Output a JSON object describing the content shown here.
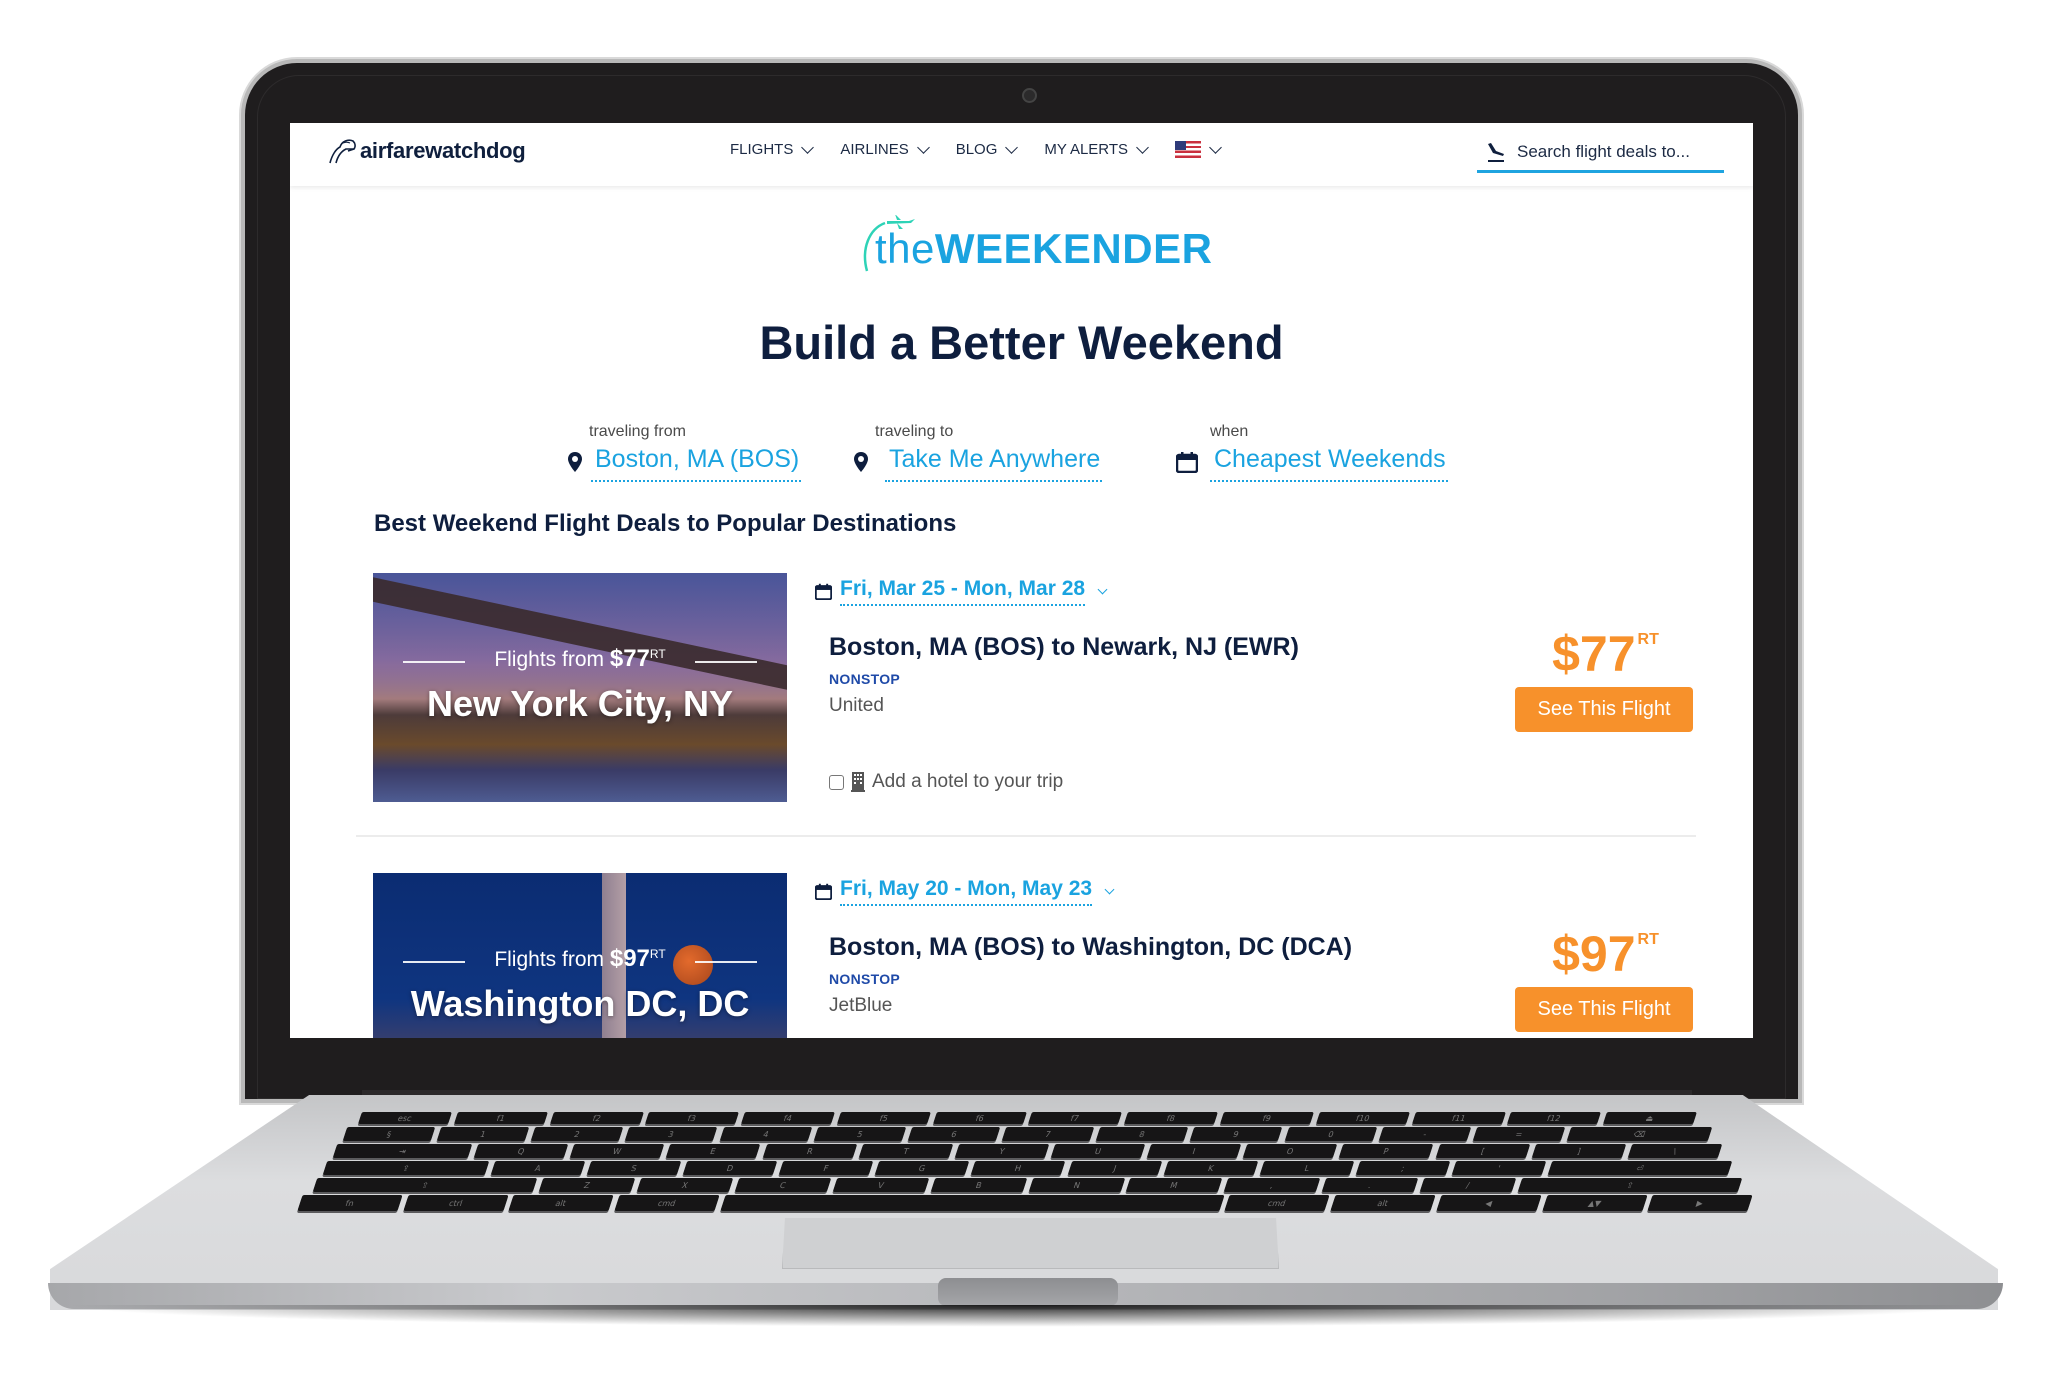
{
  "nav": {
    "brand": "airfarewatchdog",
    "items": [
      {
        "label": "FLIGHTS"
      },
      {
        "label": "AIRLINES"
      },
      {
        "label": "BLOG"
      },
      {
        "label": "MY ALERTS"
      }
    ],
    "locale_icon": "us-flag-icon",
    "search_placeholder": "Search flight deals to..."
  },
  "hero": {
    "logo_the": "the",
    "logo_weekender": "WEEKENDER",
    "title": "Build a Better Weekend"
  },
  "search": {
    "from": {
      "label": "traveling from",
      "value": "Boston, MA (BOS)",
      "icon": "map-pin-icon"
    },
    "to": {
      "label": "traveling to",
      "value": "Take Me Anywhere",
      "icon": "map-pin-icon"
    },
    "when": {
      "label": "when",
      "value": "Cheapest Weekends",
      "icon": "calendar-icon"
    }
  },
  "section_title": "Best Weekend Flight Deals to Popular Destinations",
  "deals": [
    {
      "flights_from_label": "Flights from",
      "flights_from_price": "$77",
      "rt": "RT",
      "city": "New York City, NY",
      "dates": "Fri, Mar 25 - Mon, Mar 28",
      "route": "Boston, MA (BOS) to Newark, NJ (EWR)",
      "stops": "NONSTOP",
      "airline": "United",
      "hotel_label": "Add a hotel to your trip",
      "hotel_checked": false,
      "price": "$77",
      "price_suffix": "RT",
      "cta": "See This Flight"
    },
    {
      "flights_from_label": "Flights from",
      "flights_from_price": "$97",
      "rt": "RT",
      "city": "Washington DC, DC",
      "dates": "Fri, May 20 - Mon, May 23",
      "route": "Boston, MA (BOS) to Washington, DC (DCA)",
      "stops": "NONSTOP",
      "airline": "JetBlue",
      "price": "$97",
      "price_suffix": "RT",
      "cta": "See This Flight"
    }
  ],
  "colors": {
    "accent": "#1aa3e0",
    "navy": "#0e1e3e",
    "cta": "#f7912b",
    "logo_swoosh": "#2ed3b7"
  },
  "keyboard": {
    "row0": [
      "esc",
      "f1",
      "f2",
      "f3",
      "f4",
      "f5",
      "f6",
      "f7",
      "f8",
      "f9",
      "f10",
      "f11",
      "f12",
      "⏏"
    ],
    "row1": [
      "§",
      "1",
      "2",
      "3",
      "4",
      "5",
      "6",
      "7",
      "8",
      "9",
      "0",
      "-",
      "=",
      "⌫"
    ],
    "row2": [
      "⇥",
      "Q",
      "W",
      "E",
      "R",
      "T",
      "Y",
      "U",
      "I",
      "O",
      "P",
      "[",
      "]",
      "\\"
    ],
    "row3": [
      "⇪",
      "A",
      "S",
      "D",
      "F",
      "G",
      "H",
      "J",
      "K",
      "L",
      ";",
      "'",
      "⏎"
    ],
    "row4": [
      "⇧",
      "Z",
      "X",
      "C",
      "V",
      "B",
      "N",
      "M",
      ",",
      ".",
      "/",
      "⇧"
    ],
    "row5": [
      "fn",
      "ctrl",
      "alt",
      "cmd",
      "",
      "cmd",
      "alt",
      "◀",
      "▲▼",
      "▶"
    ]
  }
}
